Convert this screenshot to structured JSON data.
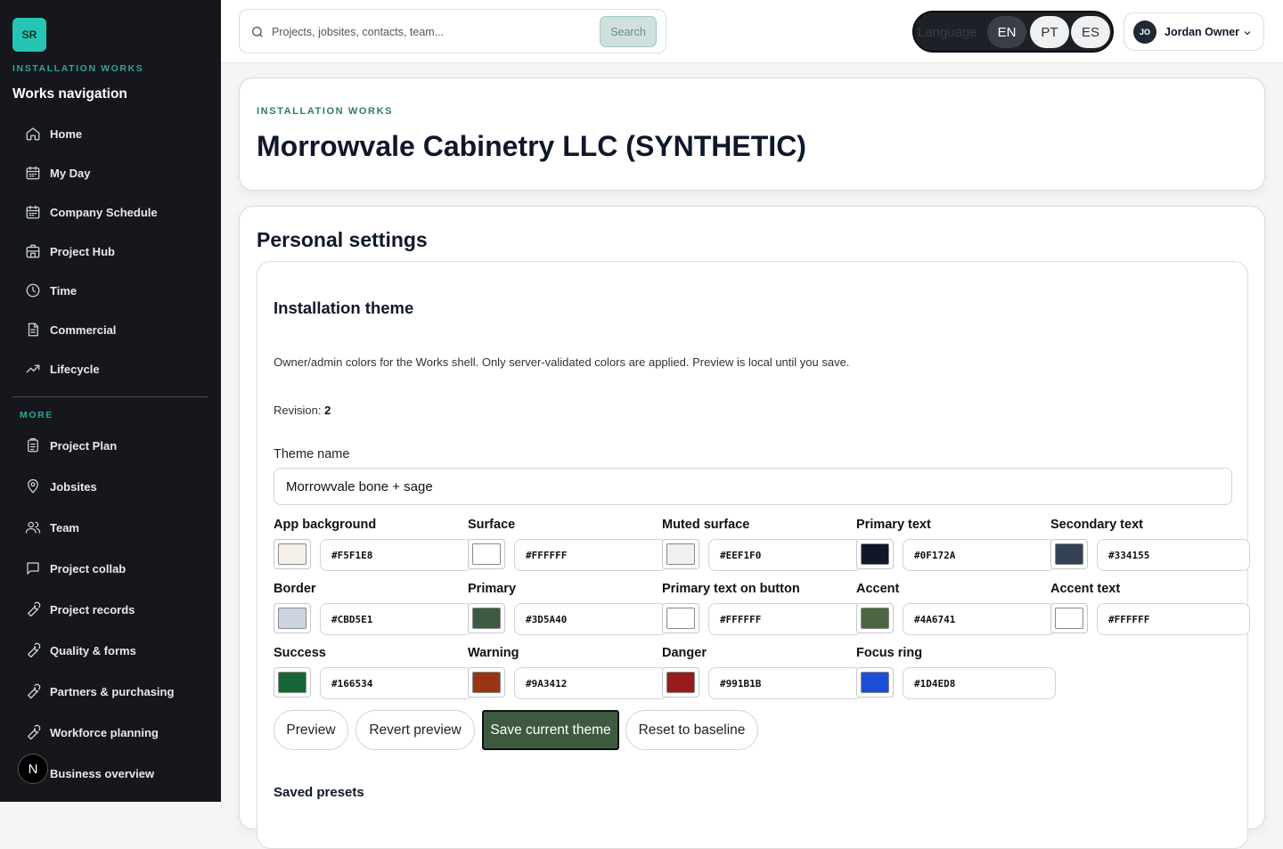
{
  "sidebar": {
    "logo_text": "SR",
    "kicker": "INSTALLATION WORKS",
    "title": "Works navigation",
    "items": [
      {
        "label": "Home",
        "icon": "home-icon"
      },
      {
        "label": "My Day",
        "icon": "calendar-icon"
      },
      {
        "label": "Company Schedule",
        "icon": "calendar-icon"
      },
      {
        "label": "Project Hub",
        "icon": "building-icon"
      },
      {
        "label": "Time",
        "icon": "clock-icon"
      },
      {
        "label": "Commercial",
        "icon": "document-icon"
      },
      {
        "label": "Lifecycle",
        "icon": "trend-icon"
      }
    ],
    "more_label": "MORE",
    "more_items": [
      {
        "label": "Project Plan",
        "icon": "clipboard-icon"
      },
      {
        "label": "Jobsites",
        "icon": "map-pin-icon"
      },
      {
        "label": "Team",
        "icon": "users-icon"
      },
      {
        "label": "Project collab",
        "icon": "chat-icon"
      },
      {
        "label": "Project records",
        "icon": "wrench-icon"
      },
      {
        "label": "Quality & forms",
        "icon": "wrench-icon"
      },
      {
        "label": "Partners & purchasing",
        "icon": "wrench-icon"
      },
      {
        "label": "Workforce planning",
        "icon": "wrench-icon"
      },
      {
        "label": "Business overview",
        "icon": "wrench-icon"
      }
    ],
    "badge": "N"
  },
  "topbar": {
    "search_placeholder": "Projects, jobsites, contacts, team...",
    "search_button": "Search",
    "language_label": "Language",
    "languages": [
      "EN",
      "PT",
      "ES"
    ],
    "active_language": "EN",
    "user_initials": "JO",
    "user_name": "Jordan Owner"
  },
  "org": {
    "kicker": "INSTALLATION WORKS",
    "title": "Morrowvale Cabinetry LLC (SYNTHETIC)"
  },
  "settings": {
    "title": "Personal settings",
    "theme": {
      "heading": "Installation theme",
      "description": "Owner/admin colors for the Works shell. Only server-validated colors are applied. Preview is local until you save.",
      "revision_label": "Revision:",
      "revision_value": "2",
      "name_label": "Theme name",
      "name_value": "Morrowvale bone + sage",
      "colors": [
        {
          "label": "App background",
          "hex": "#F5F1E8"
        },
        {
          "label": "Surface",
          "hex": "#FFFFFF"
        },
        {
          "label": "Muted surface",
          "hex": "#EEF1F0"
        },
        {
          "label": "Primary text",
          "hex": "#0F172A"
        },
        {
          "label": "Secondary text",
          "hex": "#334155"
        },
        {
          "label": "Border",
          "hex": "#CBD5E1"
        },
        {
          "label": "Primary",
          "hex": "#3D5A40"
        },
        {
          "label": "Primary text on button",
          "hex": "#FFFFFF"
        },
        {
          "label": "Accent",
          "hex": "#4A6741"
        },
        {
          "label": "Accent text",
          "hex": "#FFFFFF"
        },
        {
          "label": "Success",
          "hex": "#166534"
        },
        {
          "label": "Warning",
          "hex": "#9A3412"
        },
        {
          "label": "Danger",
          "hex": "#991B1B"
        },
        {
          "label": "Focus ring",
          "hex": "#1D4ED8"
        }
      ],
      "buttons": {
        "preview": "Preview",
        "revert": "Revert preview",
        "save": "Save current theme",
        "reset": "Reset to baseline"
      },
      "presets_heading": "Saved presets"
    }
  }
}
